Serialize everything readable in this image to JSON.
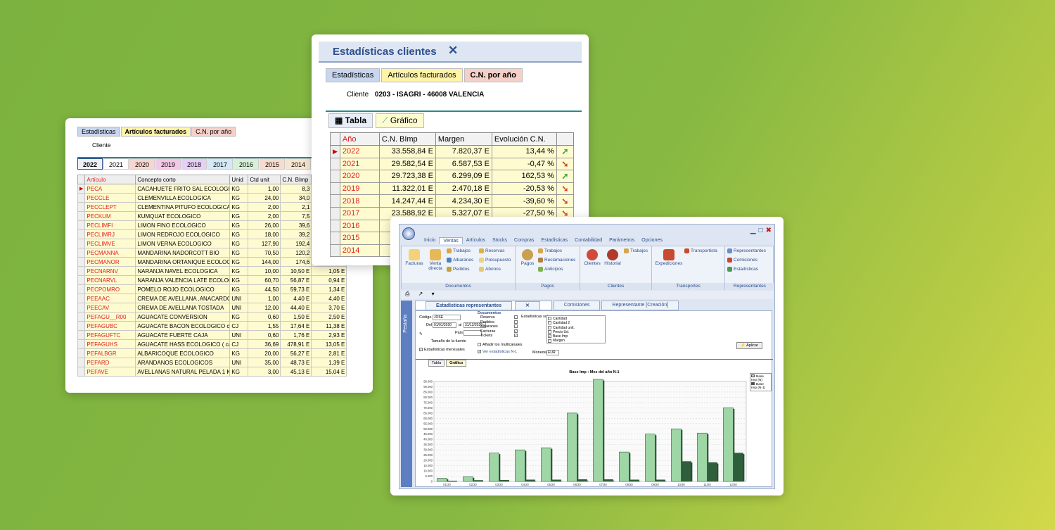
{
  "card1": {
    "tabs": [
      "Estadísticas",
      "Artículos facturados",
      "C.N. por año"
    ],
    "cliente_label": "Cliente",
    "years": [
      "2022",
      "2021",
      "2020",
      "2019",
      "2018",
      "2017",
      "2016",
      "2015",
      "2014"
    ],
    "columns": [
      "Artículo",
      "Concepto corto",
      "Unid",
      "Ctd unit",
      "C.N. BImp",
      ""
    ],
    "rows": [
      [
        "PECA",
        "CACAHUETE FRITO SAL ECOLOGICO",
        "KG",
        "1,00",
        "8,3",
        ""
      ],
      [
        "PECCLE",
        "CLEMENVILLA ECOLOGICA",
        "KG",
        "24,00",
        "34,0",
        ""
      ],
      [
        "PECCLEPT",
        "CLEMENTINA PITUFO ECOLOGICA",
        "KG",
        "2,00",
        "2,1",
        ""
      ],
      [
        "PECKUM",
        "KUMQUAT ECOLOGICO",
        "KG",
        "2,00",
        "7,5",
        ""
      ],
      [
        "PECLIMFI",
        "LIMON FINO ECOLOGICO",
        "KG",
        "26,00",
        "39,6",
        ""
      ],
      [
        "PECLIMRJ",
        "LIMON REDROJO ECOLOGICO",
        "KG",
        "18,00",
        "39,2",
        ""
      ],
      [
        "PECLIMVE",
        "LIMON VERNA ECOLOGICO",
        "KG",
        "127,90",
        "192,4",
        ""
      ],
      [
        "PECMANNA",
        "MANDARINA NADORCOTT BIO",
        "KG",
        "70,50",
        "120,2",
        ""
      ],
      [
        "PECMANOR",
        "MANDARINA ORTANIQUE ECOLOGICA",
        "KG",
        "144,00",
        "174,6",
        ""
      ],
      [
        "PECNARNV",
        "NARANJA NAVEL ECOLOGICA",
        "KG",
        "10,00",
        "10,50 E",
        "1,05 E"
      ],
      [
        "PECNARVL",
        "NARANJA VALENCIA LATE ECOLOGICA",
        "KG",
        "60,70",
        "56,87 E",
        "0,94 E"
      ],
      [
        "PECPOMRO",
        "POMELO ROJO ECOLOGICO",
        "KG",
        "44,50",
        "59,73 E",
        "1,34 E"
      ],
      [
        "PEEAAC",
        "CREMA DE AVELLANA ,ANACARDO Y CACAO",
        "UNI",
        "1,00",
        "4,40 E",
        "4,40 E"
      ],
      [
        "PEECAV",
        "CREMA DE AVELLANA TOSTADA",
        "UNI",
        "12,00",
        "44,40 E",
        "3,70 E"
      ],
      [
        "PEFAGU__R00",
        "AGUACATE   CONVERSION",
        "KG",
        "0,60",
        "1,50 E",
        "2,50 E"
      ],
      [
        "PEFAGUBC",
        "AGUACATE BACON ECOLOGICO caja",
        "CJ",
        "1,55",
        "17,64 E",
        "11,38 E"
      ],
      [
        "PEFAGUFTC",
        "AGUACATE FUERTE CAJA",
        "UNI",
        "0,60",
        "1,76 E",
        "2,93 E"
      ],
      [
        "PEFAGUHS",
        "AGUACATE HASS  ECOLOGICO    ( caja)",
        "CJ",
        "36,69",
        "478,91 E",
        "13,05 E"
      ],
      [
        "PEFALBGR",
        "ALBARICOQUE ECOLOGICO",
        "KG",
        "20,00",
        "56,27 E",
        "2,81 E"
      ],
      [
        "PEFARD",
        "ARANDANOS ECOLOGICOS",
        "UNI",
        "35,00",
        "48,73 E",
        "1,39 E"
      ],
      [
        "PEFAVE",
        "AVELLANAS NATURAL PELADA 1 KGS",
        "KG",
        "3,00",
        "45,13 E",
        "15,04 E"
      ]
    ]
  },
  "card2": {
    "title": "Estadísticas clientes",
    "close": "✕",
    "tabs": [
      "Estadísticas",
      "Artículos facturados",
      "C.N. por año"
    ],
    "cliente_label": "Cliente",
    "cliente_value": "0203 - ISAGRI - 46008  VALENCIA",
    "view_tabs": [
      "Tabla",
      "Gráfico"
    ],
    "columns": [
      "Año",
      "C.N. BImp",
      "Margen",
      "Evolución C.N.",
      ""
    ],
    "rows": [
      [
        "2022",
        "33.558,84 E",
        "7.820,37 E",
        "13,44 %",
        "up"
      ],
      [
        "2021",
        "29.582,54 E",
        "6.587,53 E",
        "-0,47 %",
        "down"
      ],
      [
        "2020",
        "29.723,38 E",
        "6.299,09 E",
        "162,53 %",
        "up"
      ],
      [
        "2019",
        "11.322,01 E",
        "2.470,18 E",
        "-20,53 %",
        "down"
      ],
      [
        "2018",
        "14.247,44 E",
        "4.234,30 E",
        "-39,60 %",
        "down"
      ],
      [
        "2017",
        "23.588,92 E",
        "5.327,07 E",
        "-27,50 %",
        "down"
      ],
      [
        "2016",
        "",
        "",
        "",
        ""
      ],
      [
        "2015",
        "",
        "",
        "",
        ""
      ],
      [
        "2014",
        "",
        "",
        "",
        ""
      ]
    ]
  },
  "card3": {
    "menu": [
      "Inicio",
      "Ventas",
      "Artículos",
      "Stocks",
      "Compras",
      "Estadísticas",
      "Contabilidad",
      "Parámetros",
      "Opciones"
    ],
    "groups": {
      "documentos": {
        "label": "Documentos",
        "big": [
          "Facturas",
          "Venta directa"
        ],
        "small": [
          "Trabajos",
          "Albaranes",
          "Pedidos",
          "Reservas",
          "Presupuesto",
          "Abonos"
        ]
      },
      "pagos": {
        "label": "Pagos",
        "big": [
          "Pagos"
        ],
        "small": [
          "Trabajos",
          "Reclamaciones",
          "Anticipos"
        ]
      },
      "clientes": {
        "label": "Clientes",
        "big": [
          "Clientes",
          "Historial"
        ],
        "small": [
          "Trabajos"
        ]
      },
      "transportes": {
        "label": "Transportes",
        "big": [
          "Expediciones"
        ],
        "small": [
          "Transportista"
        ]
      },
      "representantes": {
        "label": "Representantes",
        "small": [
          "Representantes",
          "Comisiones",
          "Estadísticas"
        ]
      }
    },
    "side_label": "Pestaña",
    "doc_tabs": [
      "Estadísticas representantes",
      "Comisiones",
      "Representante [Creación]"
    ],
    "form": {
      "codigo_label": "Código",
      "codigo_value": "JOSE",
      "del_label": "Del",
      "del_value": "01/01/2020",
      "al_label": "al",
      "al_value": "31/12/2020",
      "pais_label": "País",
      "tamano_label": "Tamaño de la fuente",
      "mensuales_label": "Estadísticas mensuales",
      "documentos_title": "Documentos",
      "documentos": [
        "Reserva",
        "Pedidos",
        "Albaranes",
        "Facturas",
        "Tickets"
      ],
      "documentos_checked": [
        false,
        false,
        false,
        true,
        true
      ],
      "sobre_label": "Estadísticas sobre",
      "sobre_items": [
        "Cantidad",
        "Cantidad 2",
        "Cantidad unit.",
        "Precio Ud.",
        "Base Imp",
        "Margen"
      ],
      "sobre_checked": [
        false,
        false,
        false,
        false,
        true,
        false
      ],
      "anadir_label": "Añadir los multicanales",
      "ver_label": "Ver estadísticas N-1",
      "moneda_label": "Moneda",
      "moneda_value": "EUR",
      "aplicar": "Aplicar"
    },
    "chart_tabs": [
      "Tabla",
      "Gráfico"
    ]
  },
  "chart_data": {
    "type": "bar",
    "title": "Base Imp : Mes del año N-1",
    "categories": [
      "01/20",
      "02/20",
      "03/20",
      "04/20",
      "05/20",
      "06/20",
      "07/20",
      "08/20",
      "09/20",
      "10/20",
      "11/20",
      "12/20"
    ],
    "series": [
      {
        "name": "Base Imp (N)",
        "values": [
          3000,
          4500,
          27000,
          30000,
          32000,
          65000,
          97000,
          28000,
          45000,
          50000,
          46000,
          70000
        ]
      },
      {
        "name": "Base Imp (N-1)",
        "values": [
          500,
          1000,
          1200,
          1500,
          1500,
          1800,
          1800,
          1500,
          1500,
          19000,
          18000,
          27000
        ]
      }
    ],
    "ylim": [
      0,
      95000
    ],
    "yticks": [
      "0",
      "5.000",
      "10.000",
      "15.000",
      "20.000",
      "25.000",
      "30.000",
      "35.000",
      "40.000",
      "45.000",
      "50.000",
      "55.000",
      "60.000",
      "65.000",
      "70.000",
      "75.000",
      "80.000",
      "85.000",
      "90.000",
      "95.000"
    ],
    "colors": {
      "n": "#9ed6a6",
      "n1": "#2f5e3c"
    }
  }
}
